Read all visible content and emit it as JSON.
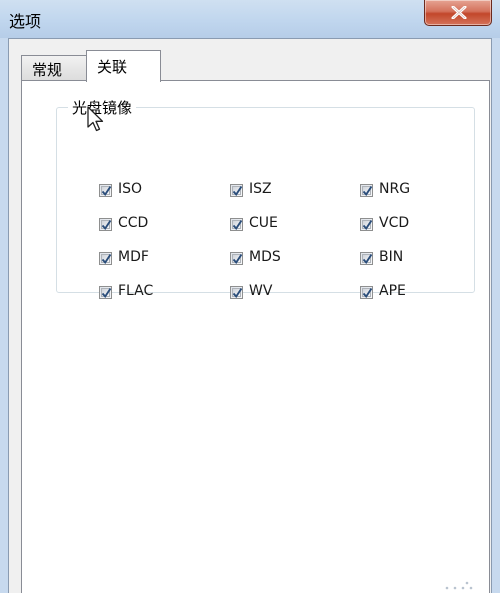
{
  "window": {
    "title": "选项",
    "close_icon": "close-icon"
  },
  "tabs": [
    {
      "label": "常规",
      "selected": false
    },
    {
      "label": "关联",
      "selected": true
    }
  ],
  "group": {
    "label": "光盘镜像",
    "options": [
      {
        "label": "ISO",
        "checked": true
      },
      {
        "label": "ISZ",
        "checked": true
      },
      {
        "label": "NRG",
        "checked": true
      },
      {
        "label": "CCD",
        "checked": true
      },
      {
        "label": "CUE",
        "checked": true
      },
      {
        "label": "VCD",
        "checked": true
      },
      {
        "label": "MDF",
        "checked": true
      },
      {
        "label": "MDS",
        "checked": true
      },
      {
        "label": "BIN",
        "checked": true
      },
      {
        "label": "FLAC",
        "checked": true
      },
      {
        "label": "WV",
        "checked": true
      },
      {
        "label": "APE",
        "checked": true
      }
    ]
  },
  "colors": {
    "titlebar": "#c7d9ee",
    "close_button": "#c2472b",
    "checkmark": "#2a4d7a"
  }
}
